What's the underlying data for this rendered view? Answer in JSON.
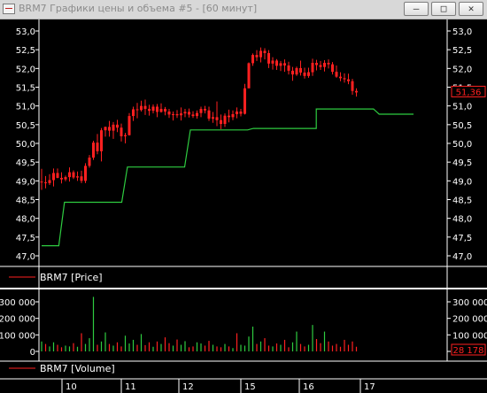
{
  "window": {
    "title": "BRM7 Графики цены и объема #5 - [60 минут]",
    "buttons": {
      "minimize": "–",
      "maximize": "□",
      "close": "✕"
    }
  },
  "price_panel": {
    "legend": "BRM7 [Price]",
    "last_value": "51,36",
    "y_ticks": [
      "53,0",
      "52,5",
      "52,0",
      "51,5",
      "51,0",
      "50,5",
      "50,0",
      "49,5",
      "49,0",
      "48,5",
      "48,0",
      "47,5",
      "47,0"
    ]
  },
  "volume_panel": {
    "legend": "BRM7 [Volume]",
    "last_value": "28 178",
    "y_ticks": [
      "300 000",
      "200 000",
      "100 000",
      "0"
    ]
  },
  "time_axis": {
    "labels": [
      "10",
      "11",
      "12",
      "15",
      "16",
      "17"
    ]
  },
  "colors": {
    "background": "#000000",
    "candle": "#ff2020",
    "indicator_line": "#2ecc40",
    "volume_up": "#2ecc40",
    "volume_down": "#ff2020",
    "text": "#ffffff"
  },
  "chart_data": [
    {
      "type": "candlestick",
      "series": [
        {
          "name": "BRM7 [Price]",
          "bars": [
            [
              48.98,
              49.32,
              48.76,
              48.96
            ],
            [
              48.96,
              49.13,
              48.8,
              48.94
            ],
            [
              48.94,
              49.18,
              48.89,
              49.02
            ],
            [
              49.02,
              49.33,
              48.85,
              49.21
            ],
            [
              49.21,
              49.33,
              49.07,
              49.08
            ],
            [
              49.08,
              49.23,
              48.93,
              49.04
            ],
            [
              49.04,
              49.14,
              48.99,
              49.1
            ],
            [
              49.1,
              49.36,
              48.98,
              49.23
            ],
            [
              49.23,
              49.28,
              49.05,
              49.09
            ],
            [
              49.09,
              49.25,
              49.0,
              49.12
            ],
            [
              49.12,
              49.27,
              48.94,
              49.0
            ],
            [
              49.0,
              49.47,
              48.94,
              49.4
            ],
            [
              49.4,
              49.69,
              49.35,
              49.62
            ],
            [
              49.62,
              50.07,
              49.56,
              50.02
            ],
            [
              50.02,
              50.25,
              49.71,
              49.79
            ],
            [
              49.79,
              50.41,
              49.52,
              50.35
            ],
            [
              50.35,
              50.45,
              50.18,
              50.44
            ],
            [
              50.44,
              50.6,
              50.18,
              50.34
            ],
            [
              50.34,
              50.57,
              50.12,
              50.5
            ],
            [
              50.5,
              50.63,
              50.3,
              50.42
            ],
            [
              50.42,
              50.53,
              50.05,
              50.19
            ],
            [
              50.19,
              50.28,
              50.0,
              50.22
            ],
            [
              50.22,
              50.81,
              50.21,
              50.73
            ],
            [
              50.73,
              50.98,
              50.6,
              50.91
            ],
            [
              50.91,
              51.08,
              50.67,
              50.89
            ],
            [
              50.89,
              51.14,
              50.85,
              51.0
            ],
            [
              51.0,
              51.17,
              50.76,
              50.92
            ],
            [
              50.92,
              51.03,
              50.74,
              50.87
            ],
            [
              50.87,
              51.04,
              50.8,
              50.98
            ],
            [
              50.98,
              51.05,
              50.7,
              50.84
            ],
            [
              50.84,
              51.07,
              50.82,
              50.92
            ],
            [
              50.92,
              50.97,
              50.75,
              50.85
            ],
            [
              50.85,
              50.92,
              50.68,
              50.77
            ],
            [
              50.77,
              50.85,
              50.61,
              50.78
            ],
            [
              50.78,
              50.89,
              50.68,
              50.75
            ],
            [
              50.75,
              50.96,
              50.61,
              50.8
            ],
            [
              50.8,
              50.92,
              50.7,
              50.84
            ],
            [
              50.84,
              50.93,
              50.69,
              50.77
            ],
            [
              50.77,
              50.86,
              50.68,
              50.73
            ],
            [
              50.73,
              50.88,
              50.66,
              50.81
            ],
            [
              50.81,
              50.98,
              50.7,
              50.92
            ],
            [
              50.92,
              51.0,
              50.8,
              50.88
            ],
            [
              50.88,
              50.98,
              50.6,
              50.66
            ],
            [
              50.66,
              50.84,
              50.55,
              50.7
            ],
            [
              50.7,
              51.12,
              50.46,
              50.62
            ],
            [
              50.62,
              50.77,
              50.38,
              50.52
            ],
            [
              50.52,
              50.8,
              50.44,
              50.74
            ],
            [
              50.74,
              50.9,
              50.56,
              50.7
            ],
            [
              50.7,
              50.88,
              50.62,
              50.78
            ],
            [
              50.78,
              50.96,
              50.67,
              50.85
            ],
            [
              50.85,
              50.92,
              50.72,
              50.79
            ],
            [
              50.79,
              51.59,
              50.77,
              51.47
            ],
            [
              51.47,
              52.16,
              51.47,
              52.14
            ],
            [
              52.14,
              52.4,
              52.07,
              52.36
            ],
            [
              52.36,
              52.49,
              52.2,
              52.3
            ],
            [
              52.3,
              52.56,
              52.16,
              52.47
            ],
            [
              52.47,
              52.54,
              52.24,
              52.41
            ],
            [
              52.41,
              52.49,
              52.01,
              52.13
            ],
            [
              52.13,
              52.3,
              51.97,
              52.21
            ],
            [
              52.21,
              52.25,
              51.96,
              52.07
            ],
            [
              52.07,
              52.2,
              51.93,
              52.14
            ],
            [
              52.14,
              52.24,
              51.91,
              52.08
            ],
            [
              52.08,
              52.18,
              51.84,
              51.94
            ],
            [
              51.94,
              52.04,
              51.67,
              51.84
            ],
            [
              51.84,
              52.05,
              51.8,
              52.01
            ],
            [
              52.01,
              52.21,
              51.81,
              51.89
            ],
            [
              51.89,
              52.02,
              51.73,
              51.8
            ],
            [
              51.8,
              52.02,
              51.75,
              51.9
            ],
            [
              51.9,
              52.26,
              51.8,
              52.15
            ],
            [
              52.15,
              52.23,
              51.95,
              52.09
            ],
            [
              52.09,
              52.2,
              51.96,
              52.04
            ],
            [
              52.04,
              52.22,
              51.92,
              52.15
            ],
            [
              52.15,
              52.24,
              52.0,
              52.11
            ],
            [
              52.11,
              52.17,
              51.84,
              51.91
            ],
            [
              51.91,
              52.08,
              51.75,
              51.78
            ],
            [
              51.78,
              51.9,
              51.66,
              51.74
            ],
            [
              51.74,
              51.87,
              51.62,
              51.71
            ],
            [
              51.71,
              51.86,
              51.58,
              51.66
            ],
            [
              51.66,
              51.72,
              51.3,
              51.4
            ],
            [
              51.4,
              51.47,
              51.25,
              51.36
            ]
          ]
        },
        {
          "name": "indicator",
          "steps": [
            [
              0,
              47.27
            ],
            [
              3,
              47.27
            ],
            [
              4,
              48.43
            ],
            [
              14,
              48.43
            ],
            [
              15,
              49.37
            ],
            [
              25,
              49.37
            ],
            [
              26,
              50.36
            ],
            [
              36,
              50.36
            ],
            [
              37,
              50.4
            ],
            [
              47,
              50.4
            ],
            [
              48,
              50.4
            ],
            [
              48,
              50.92
            ],
            [
              58,
              50.92
            ],
            [
              59,
              50.78
            ],
            [
              65,
              50.78
            ]
          ]
        }
      ],
      "x_labels": [
        "10",
        "11",
        "12",
        "15",
        "16",
        "17"
      ],
      "ylim": [
        46.8,
        53.2
      ]
    },
    {
      "type": "bar",
      "series": [
        {
          "name": "BRM7 [Volume]",
          "values": [
            60000,
            45000,
            30000,
            55000,
            40000,
            25000,
            35000,
            30000,
            50000,
            28000,
            110000,
            45000,
            80000,
            330000,
            40000,
            60000,
            115000,
            45000,
            35000,
            55000,
            30000,
            95000,
            48000,
            70000,
            40000,
            105000,
            38000,
            55000,
            28000,
            60000,
            45000,
            85000,
            50000,
            35000,
            72000,
            40000,
            62000,
            25000,
            30000,
            55000,
            48000,
            35000,
            64000,
            40000,
            30000,
            25000,
            45000,
            30000,
            20000,
            110000,
            40000,
            35000,
            90000,
            150000,
            45000,
            60000,
            80000,
            35000,
            30000,
            48000,
            40000,
            70000,
            25000,
            55000,
            120000,
            45000,
            30000,
            40000,
            160000,
            75000,
            50000,
            120000,
            60000,
            35000,
            45000,
            28000,
            70000,
            40000,
            60000,
            28178
          ],
          "up": [
            1,
            0,
            1,
            1,
            0,
            0,
            1,
            1,
            0,
            1,
            0,
            1,
            1,
            1,
            0,
            1,
            1,
            0,
            1,
            0,
            0,
            1,
            1,
            1,
            0,
            1,
            0,
            0,
            1,
            0,
            1,
            0,
            0,
            1,
            0,
            1,
            1,
            0,
            0,
            1,
            1,
            0,
            0,
            1,
            0,
            0,
            1,
            0,
            1,
            0,
            1,
            1,
            1,
            1,
            0,
            1,
            0,
            0,
            1,
            0,
            1,
            0,
            0,
            1,
            1,
            0,
            0,
            1,
            1,
            0,
            0,
            1,
            0,
            0,
            0,
            0,
            0,
            0,
            0,
            0
          ]
        }
      ],
      "ylim": [
        0,
        360000
      ]
    }
  ]
}
